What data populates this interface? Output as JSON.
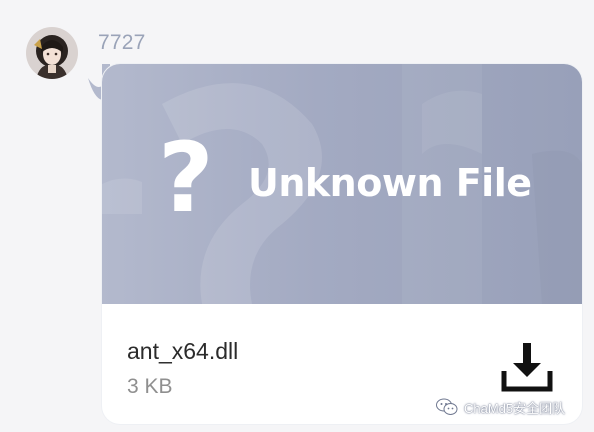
{
  "message": {
    "sender_name": "7727",
    "avatar_icon": "user-avatar"
  },
  "file_card": {
    "banner_symbol": "?",
    "banner_title": "Unknown File",
    "file_name": "ant_x64.dll",
    "file_size": "3 KB",
    "download_icon": "download-icon",
    "colors": {
      "banner_start": "#b3b9cd",
      "banner_end": "#98a0b9",
      "card_bg": "#ffffff"
    }
  },
  "watermark": {
    "icon": "wechat-icon",
    "text": "ChaMd5安全团队"
  }
}
